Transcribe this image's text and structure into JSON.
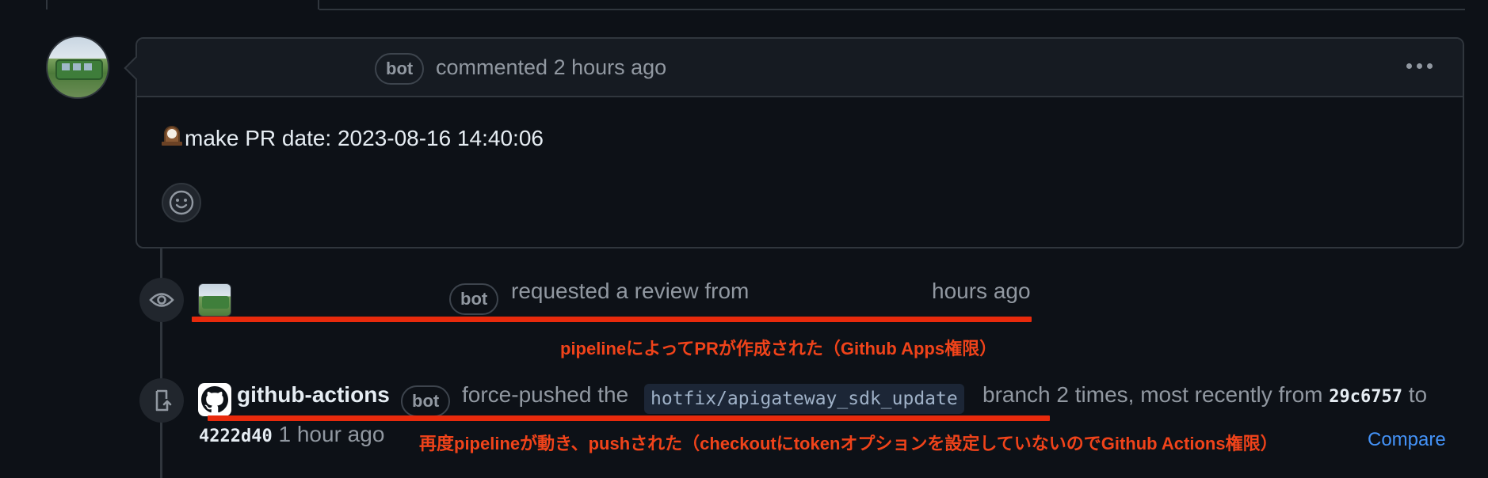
{
  "comment": {
    "badge": "bot",
    "meta": "commented 2 hours ago",
    "body": "make PR date: 2023-08-16 14:40:06"
  },
  "review_event": {
    "badge": "bot",
    "text": "requested a review from",
    "time": "hours ago",
    "annotation": "pipelineによってPRが作成された（Github Apps権限）"
  },
  "push_event": {
    "actor": "github-actions",
    "badge": "bot",
    "text_before_branch": "force-pushed the",
    "branch": "hotfix/apigateway_sdk_update",
    "text_after_branch": "branch 2 times, most recently from",
    "from_sha": "29c6757",
    "to_word": "to",
    "to_sha": "4222d40",
    "time": "1 hour ago",
    "annotation": "再度pipelineが動き、pushされた（checkoutにtokenオプションを設定していないのでGithub Actions権限）",
    "compare_label": "Compare"
  },
  "colors": {
    "background": "#0d1117",
    "border": "#30363d",
    "annotation_red": "#e82a0c",
    "link_blue": "#4493f8"
  },
  "icons": [
    "clock-emoji-icon",
    "smiley-icon",
    "eye-icon",
    "push-icon",
    "github-mark-icon",
    "kebab-icon"
  ]
}
